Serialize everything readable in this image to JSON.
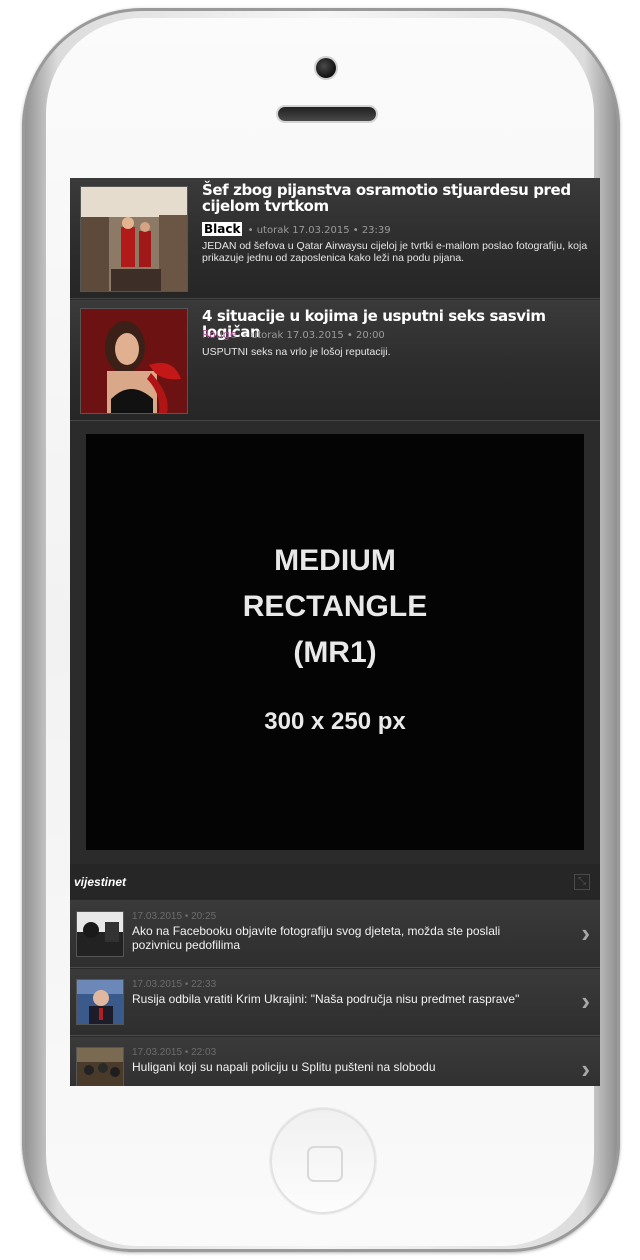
{
  "articles": [
    {
      "title": "Šef zbog pijanstva osramotio stjuardesu pred cijelom tvrtkom",
      "category": "Black",
      "meta": "• utorak 17.03.2015 • 23:39",
      "excerpt": "JEDAN od šefova u Qatar Airwaysu cijeloj je tvrtki e-mailom poslao fotografiju, koja prikazuje jednu od zaposlenica kako leži na podu pijana."
    },
    {
      "title": "4 situacije u kojima je usputni seks sasvim logičan",
      "category": "Rouge",
      "meta": "• utorak 17.03.2015 • 20:00",
      "excerpt": "USPUTNI seks na vrlo je lošoj reputaciji."
    }
  ],
  "ad": {
    "line1": "MEDIUM",
    "line2": "RECTANGLE",
    "line3": "(MR1)",
    "size": "300 x 250 px"
  },
  "vijesti": {
    "title": "vijestinet",
    "items": [
      {
        "time": "17.03.2015 • 20:25",
        "title": "Ako na Facebooku objavite fotografiju svog djeteta, možda ste poslali pozivnicu pedofilima"
      },
      {
        "time": "17.03.2015 • 22:33",
        "title": "Rusija odbila vratiti Krim Ukrajini: \"Naša područja nisu predmet rasprave\""
      },
      {
        "time": "17.03.2015 • 22:03",
        "title": "Huligani koji su napali policiju u Splitu pušteni na slobodu"
      }
    ]
  },
  "colors": {
    "screen_bg": "#2b2b2b",
    "ad_bg": "#040404",
    "rouge": "#b4519a"
  },
  "icons": {
    "arrow": "chevron-right-icon",
    "expand": "expand-icon"
  }
}
